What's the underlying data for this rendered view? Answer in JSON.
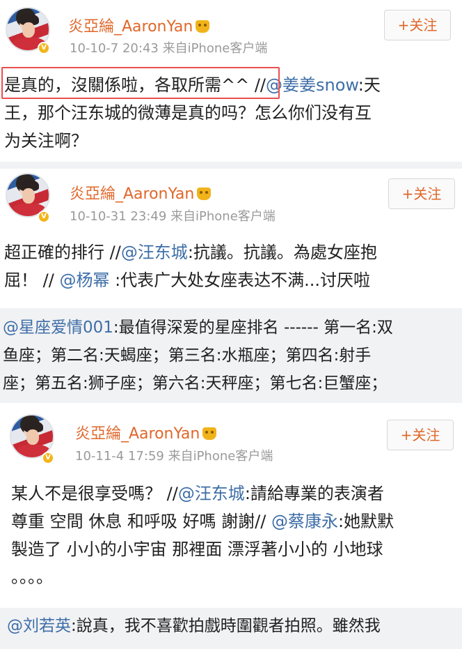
{
  "posts": [
    {
      "author": "炎亞綸_AaronYan",
      "meta": "10-10-7 20:43  来自iPhone客户端",
      "follow": "+关注",
      "highlighted": "是真的，沒關係啦，各取所需^^",
      "sep": " //",
      "mention": "@姜姜snow",
      "line1_tail": ":天",
      "line2": "王，那个汪东城的微薄是真的吗？怎么你们没有互",
      "line3": "为关注啊？"
    },
    {
      "author": "炎亞綸_AaronYan",
      "meta": "10-10-31 23:49  来自iPhone客户端",
      "follow": "+关注",
      "line1_head": "超正確的排行 //",
      "mention1": "@汪东城",
      "line1_tail": ":抗議。抗議。為處女座抱",
      "line2_head": "屈！ // ",
      "mention2": "@杨幂",
      "line2_tail": " :代表广大处女座表达不满...讨厌啦",
      "repost_mention": "@星座爱情001",
      "repost_line1_tail": ":最值得深爱的星座排名 ------ 第一名:双",
      "repost_line2": "鱼座；第二名:天蝎座；第三名:水瓶座；第四名:射手",
      "repost_line3": "座；第五名:狮子座；第六名:天秤座；第七名:巨蟹座；"
    },
    {
      "author": "炎亞綸_AaronYan",
      "meta": "10-11-4 17:59  来自iPhone客户端",
      "follow": "+关注",
      "line1_head": "某人不是很享受嗎？ //",
      "mention1": "@汪东城",
      "line1_tail": ":請給專業的表演者",
      "line2_head": "尊重 空間 休息 和呼吸 好嗎 謝謝// ",
      "mention2": "@蔡康永",
      "line2_tail": ":她默默",
      "line3": "製造了 小小的小宇宙 那裡面 漂浮著小小的 小地球",
      "line4": "。。。。",
      "repost_mention": "@刘若英",
      "repost_line1_tail": ":說真，我不喜歡拍戲時圍觀者拍照。雖然我"
    }
  ],
  "icons": {
    "verified": "V",
    "crown": "vip-crown-icon"
  },
  "colors": {
    "author": "#e0672a",
    "link": "#3e6ea7",
    "highlight_box": "#ea4e4e",
    "repost_bg": "#f1f2f4"
  }
}
